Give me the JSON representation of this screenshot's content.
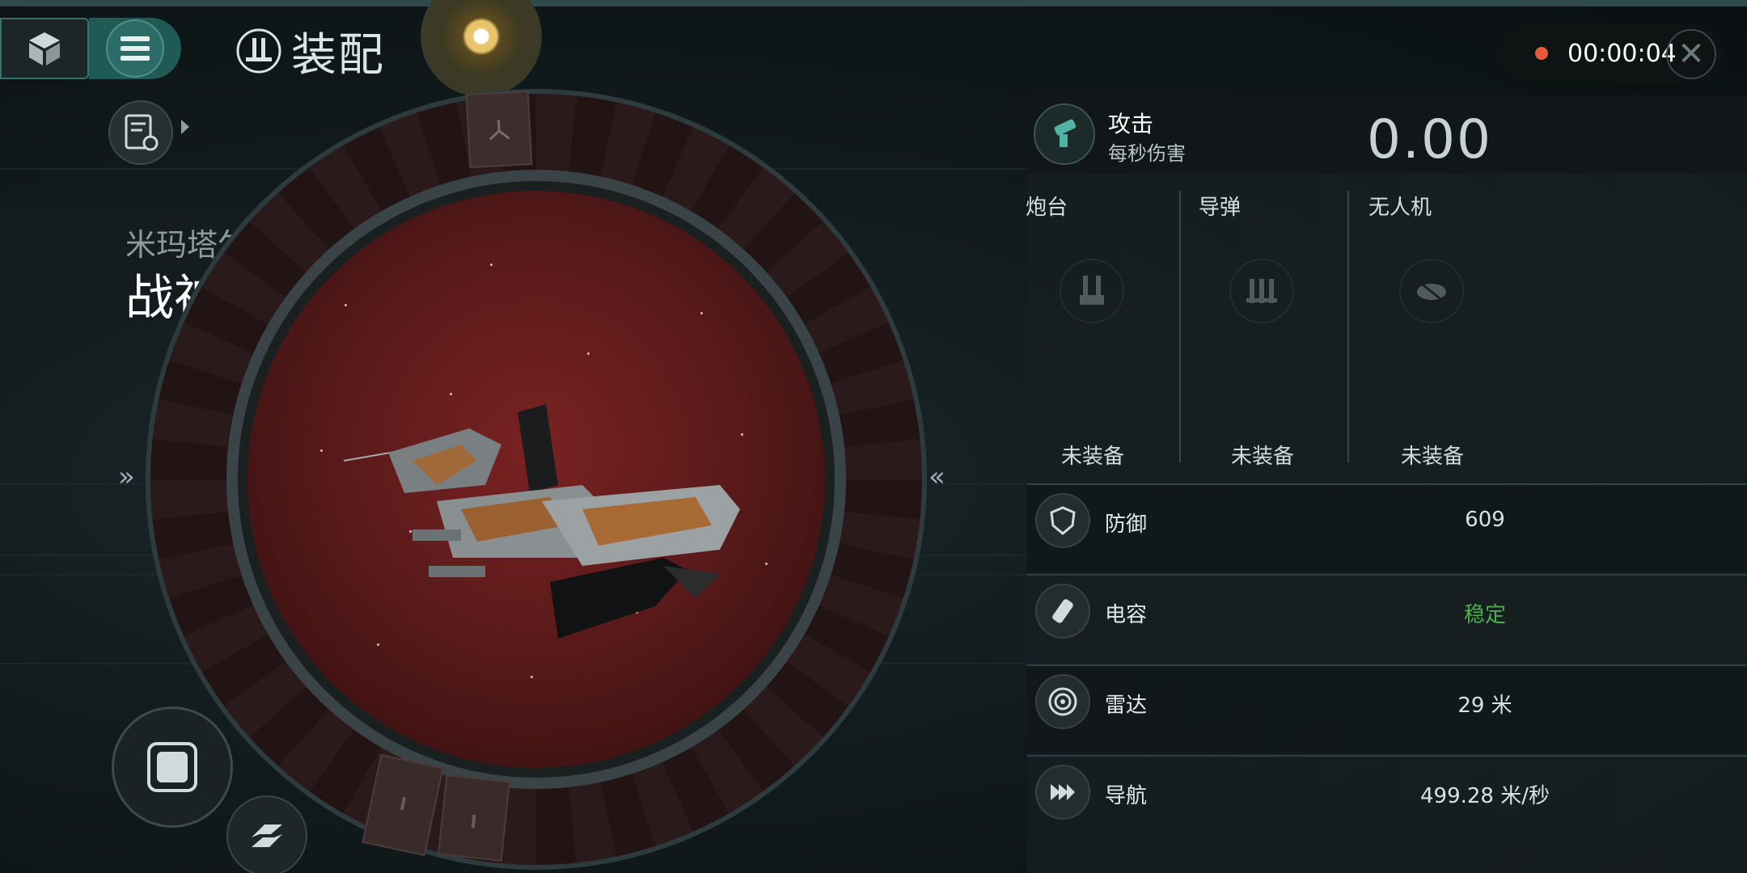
{
  "header": {
    "title": "装配",
    "recording_time": "00:00:04"
  },
  "ship": {
    "faction": "米玛塔尔",
    "name": "战神号",
    "name_arrow": "»",
    "left_arrow": "»",
    "right_arrow": "«"
  },
  "attack": {
    "title": "攻击",
    "subtitle": "每秒伤害",
    "value": "0.00"
  },
  "weapons": [
    {
      "label": "炮台",
      "status": "未装备",
      "icon": "turret-icon"
    },
    {
      "label": "导弹",
      "status": "未装备",
      "icon": "missile-icon"
    },
    {
      "label": "无人机",
      "status": "未装备",
      "icon": "drone-icon"
    }
  ],
  "stats": [
    {
      "label": "防御",
      "value": "609",
      "icon": "shield-icon"
    },
    {
      "label": "电容",
      "value": "稳定",
      "icon": "capacitor-icon",
      "color": "#4caf50"
    },
    {
      "label": "雷达",
      "value": "29 米",
      "icon": "radar-icon"
    },
    {
      "label": "导航",
      "value": "499.28 米/秒",
      "icon": "navigation-icon"
    }
  ],
  "colors": {
    "accent": "#2b6c66",
    "stable": "#4caf50",
    "record": "#e85a3c"
  }
}
